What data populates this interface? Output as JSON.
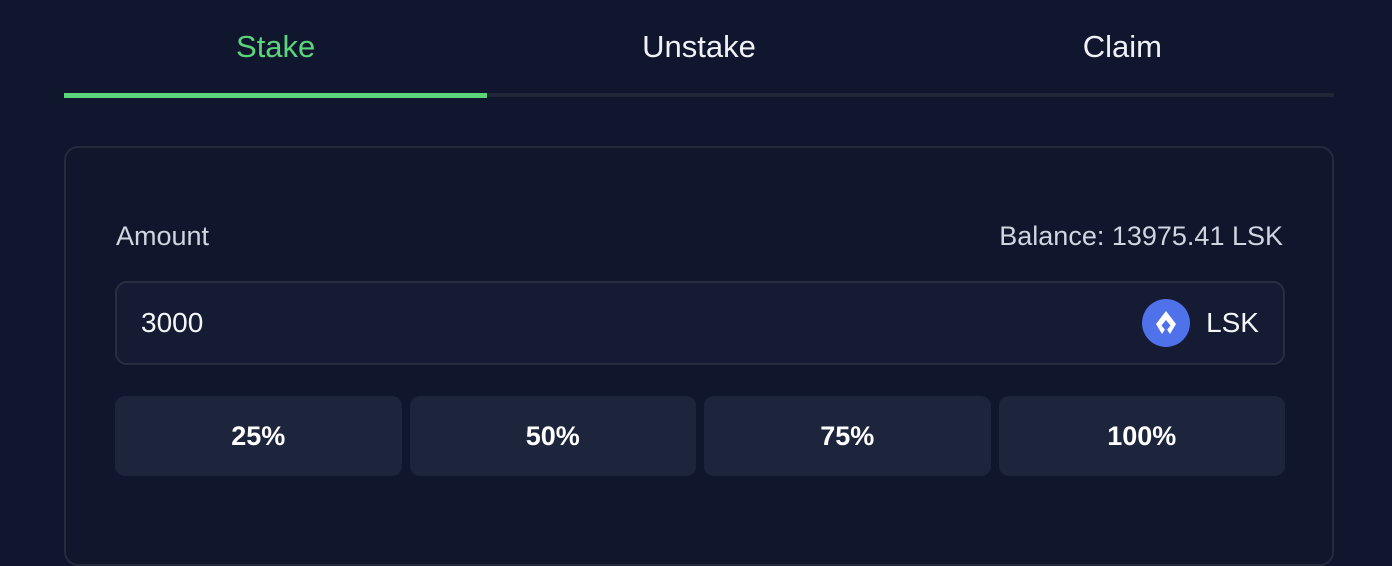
{
  "tabs": [
    {
      "label": "Stake",
      "active": true
    },
    {
      "label": "Unstake",
      "active": false
    },
    {
      "label": "Claim",
      "active": false
    }
  ],
  "stake_form": {
    "amount_label": "Amount",
    "balance_text": "Balance: 13975.41 LSK",
    "amount_value": "3000",
    "token": {
      "symbol": "LSK",
      "icon": "lisk-logo-icon",
      "color": "#4f71ea"
    },
    "percent_buttons": [
      "25%",
      "50%",
      "75%",
      "100%"
    ]
  },
  "colors": {
    "background": "#10162d",
    "accent": "#5bd47a",
    "button_bg": "#1d253c"
  }
}
